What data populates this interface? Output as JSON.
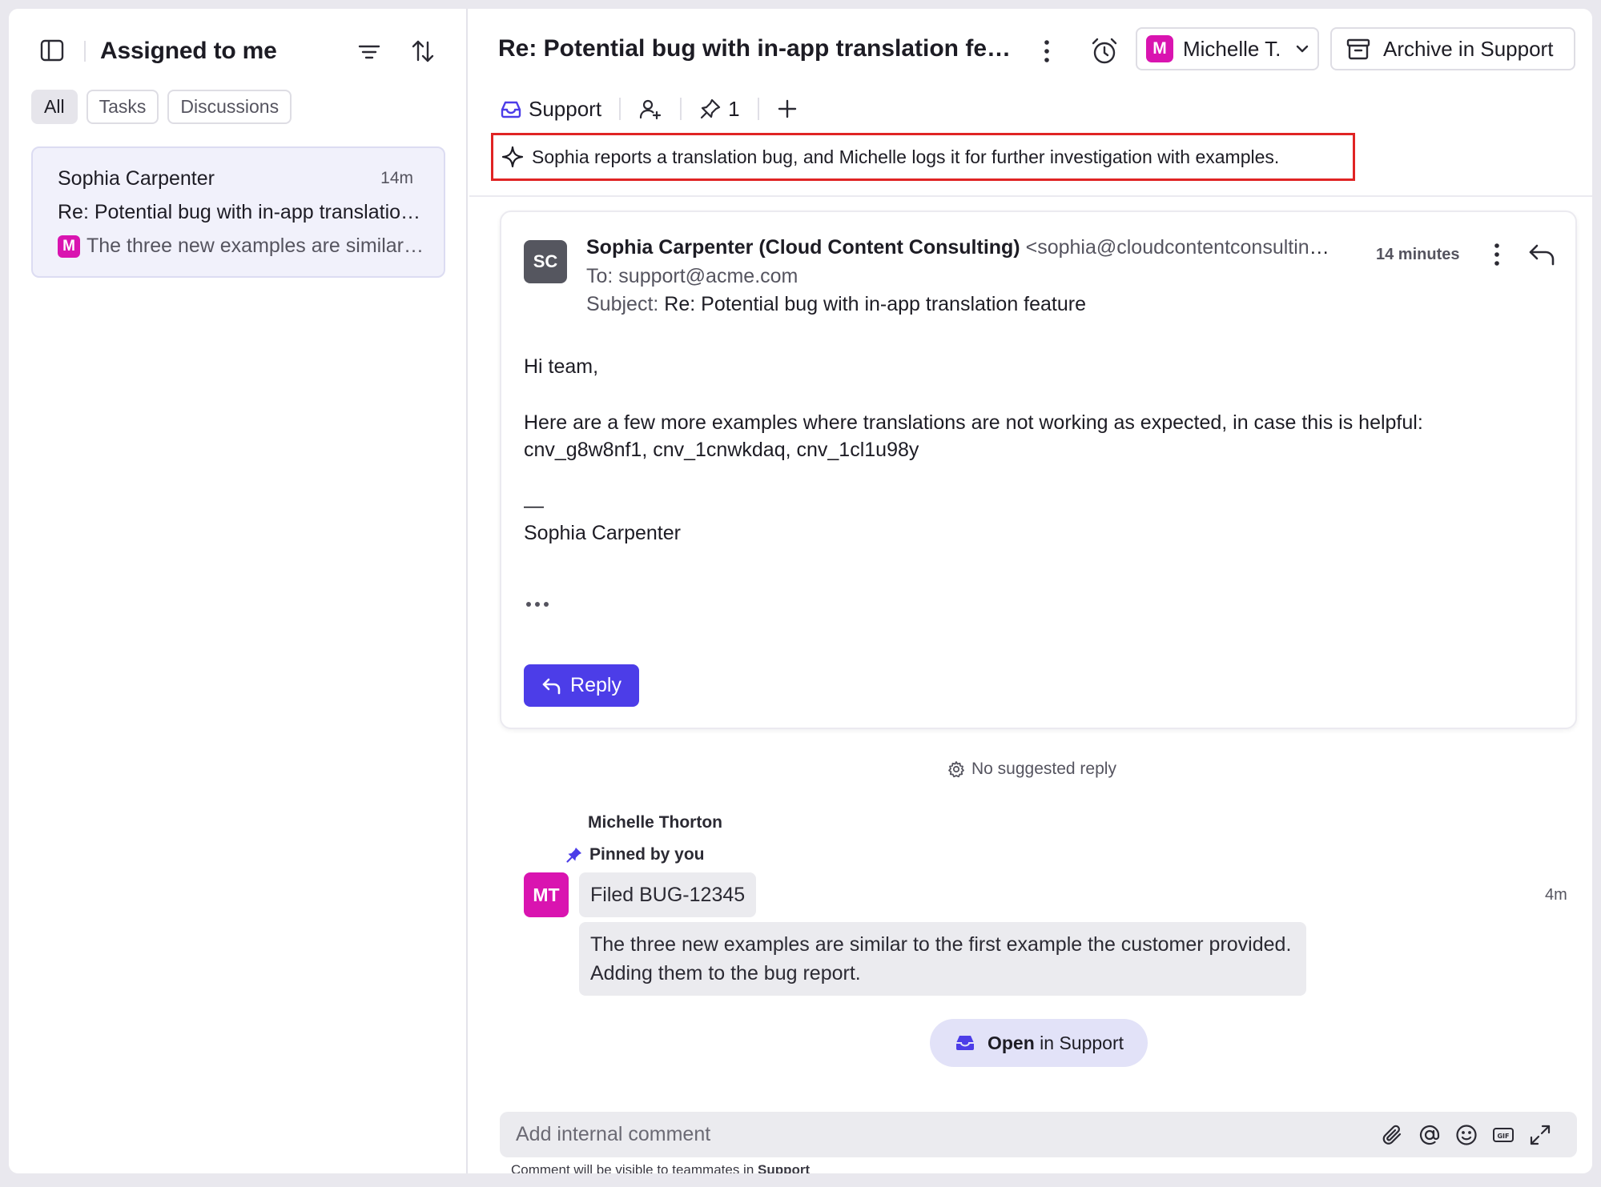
{
  "left_pane": {
    "title": "Assigned to me",
    "filters": [
      "All",
      "Tasks",
      "Discussions"
    ],
    "conversation": {
      "name": "Sophia Carpenter",
      "time": "14m",
      "subject": "Re: Potential bug with in-app translation feature",
      "preview_badge": "M",
      "preview": "The three new examples are similar to the first example the customer provided."
    }
  },
  "header": {
    "title": "Re: Potential bug with in-app translation feature",
    "assignee_badge": "M",
    "assignee": "Michelle T.",
    "archive_label": "Archive in Support",
    "inbox_label": "Support",
    "pin_count": "1"
  },
  "ai_summary": "Sophia reports a translation bug, and Michelle logs it for further investigation with examples.",
  "email": {
    "avatar_initials": "SC",
    "from_name": "Sophia Carpenter (Cloud Content Consulting)",
    "from_email": "<sophia@cloudcontentconsulting.com>",
    "to": "To: support@acme.com",
    "subject_label": "Subject:",
    "subject": "Re: Potential bug with in-app translation feature",
    "time": "14 minutes",
    "greeting": "Hi team,",
    "body_line1": "Here are a few more examples where translations are not working as expected, in case this is helpful:",
    "body_line2": "cnv_g8w8nf1, cnv_1cnwkdaq, cnv_1cl1u98y",
    "sig_dash": "—",
    "signature": "Sophia Carpenter",
    "reply_label": "Reply"
  },
  "no_suggested_reply": "No suggested reply",
  "comment": {
    "author": "Michelle Thorton",
    "pinned": "Pinned by you",
    "avatar_initials": "MT",
    "line1": "Filed BUG-12345",
    "time": "4m",
    "line2": "The three new examples are similar to the first example the customer provided. Adding them to the bug report."
  },
  "open_pill": {
    "bold": "Open",
    "rest": "in Support"
  },
  "composer": {
    "placeholder": "Add internal comment",
    "note_prefix": "Comment will be visible to teammates in",
    "note_inbox": "Support"
  },
  "colors": {
    "accent": "#4c3de8",
    "magenta_badge": "#d914b0",
    "summary_border": "#e02424"
  },
  "icons": [
    "sidebar-toggle-icon",
    "filter-icon",
    "sort-icon",
    "more-vertical-icon",
    "alarm-clock-icon",
    "chevron-down-icon",
    "archive-icon",
    "inbox-icon",
    "add-user-icon",
    "pin-icon",
    "plus-icon",
    "sparkle-icon",
    "reply-arrow-icon",
    "gear-icon",
    "paperclip-icon",
    "at-icon",
    "emoji-icon",
    "gif-icon",
    "expand-icon"
  ]
}
